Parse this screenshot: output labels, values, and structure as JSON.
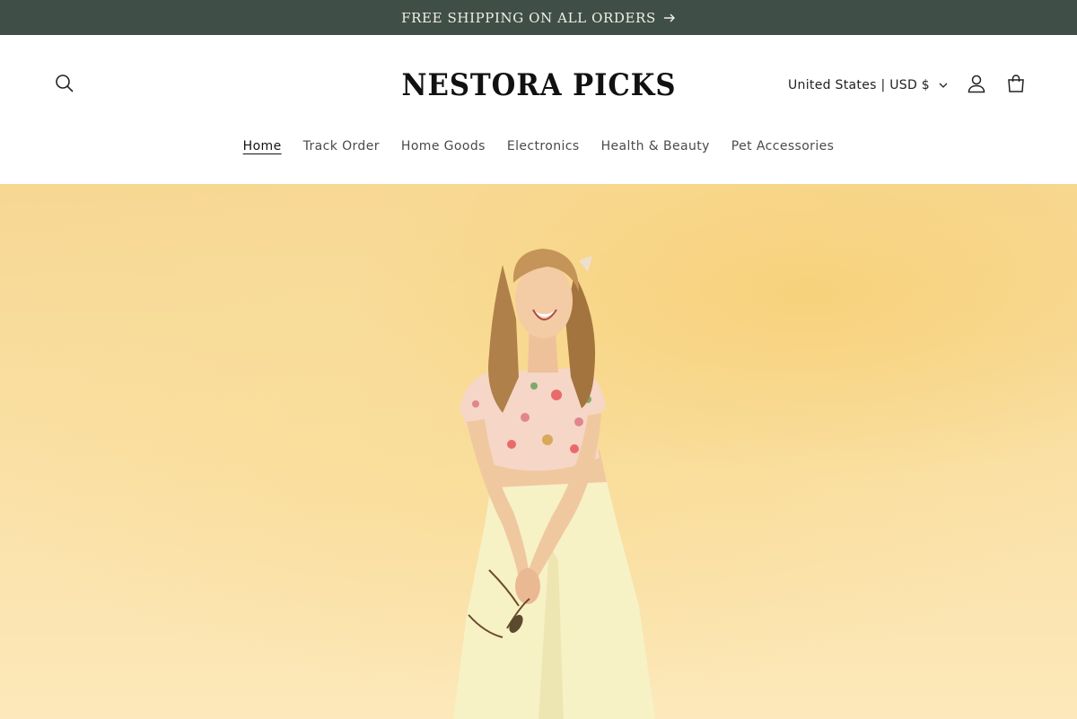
{
  "announcement": {
    "text": "FREE SHIPPING ON ALL ORDERS",
    "arrow_icon": "arrow-right-icon"
  },
  "header": {
    "logo": "NESTORA PICKS",
    "locale": "United States | USD $",
    "icons": [
      "search-icon",
      "chevron-down-icon",
      "account-icon",
      "cart-icon"
    ]
  },
  "nav": {
    "items": [
      {
        "label": "Home",
        "active": true
      },
      {
        "label": "Track Order"
      },
      {
        "label": "Home Goods"
      },
      {
        "label": "Electronics"
      },
      {
        "label": "Health & Beauty"
      },
      {
        "label": "Pet Accessories"
      }
    ]
  },
  "colors": {
    "announcement_bg": "#3f4f47",
    "hero_bg": "#f9dc97"
  }
}
